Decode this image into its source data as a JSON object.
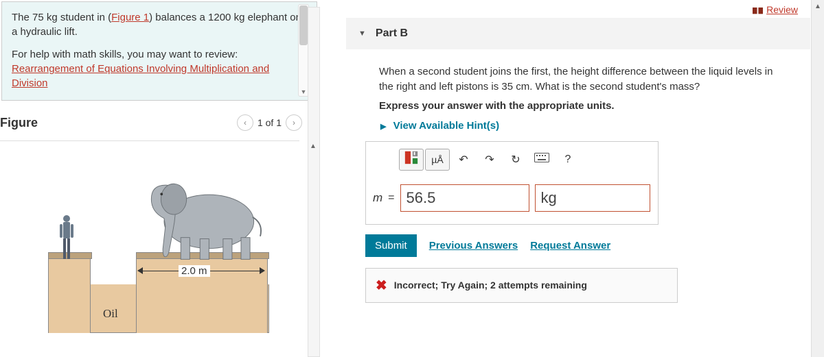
{
  "review_label": "Review",
  "info": {
    "para1_a": "The 75 ",
    "para1_b": " student in (",
    "para1_link": "Figure 1",
    "para1_c": ") balances a 1200 ",
    "para1_d": " elephant on a hydraulic lift.",
    "unit_kg": "kg",
    "para2_a": "For help with math skills, you may want to review: ",
    "para2_link": "Rearrangement of Equations Involving Multiplication and Division"
  },
  "figure": {
    "title": "Figure",
    "counter": "1 of 1",
    "span_label": "2.0 m",
    "oil_label": "Oil"
  },
  "part": {
    "label": "Part B",
    "prompt": "When a second student joins the first, the height difference between the liquid levels in the right and left pistons is 35 cm. What is the second student's mass?",
    "instruction": "Express your answer with the appropriate units.",
    "hints": "View Available Hint(s)"
  },
  "toolbar": {
    "template": "template-icon",
    "special": "µÅ",
    "undo": "↶",
    "redo": "↷",
    "reset": "↻",
    "keyboard": "⌨",
    "help": "?"
  },
  "answer": {
    "var": "m",
    "eq": "=",
    "value": "56.5",
    "unit": "kg"
  },
  "actions": {
    "submit": "Submit",
    "previous": "Previous Answers",
    "request": "Request Answer"
  },
  "feedback": {
    "text": "Incorrect; Try Again; 2 attempts remaining"
  }
}
